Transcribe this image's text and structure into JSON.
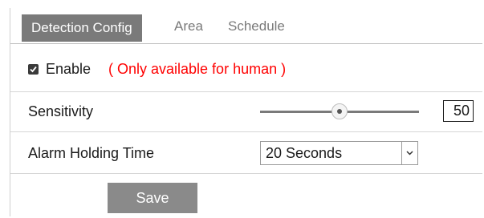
{
  "tabs": [
    {
      "label": "Detection Config",
      "active": true
    },
    {
      "label": "Area",
      "active": false
    },
    {
      "label": "Schedule",
      "active": false
    }
  ],
  "enable": {
    "checked": true,
    "label": "Enable",
    "note": "( Only available for human )",
    "note_color": "#ff0000"
  },
  "sensitivity": {
    "label": "Sensitivity",
    "value": "50",
    "level_percent": 50
  },
  "alarm": {
    "label": "Alarm Holding Time",
    "selected": "20 Seconds"
  },
  "actions": {
    "save_label": "Save"
  },
  "icons": {
    "checkbox": "check-icon",
    "dropdown": "chevron-down-icon"
  },
  "colors": {
    "active_tab_bg": "#7a7a7a",
    "button_bg": "#8a8a8a"
  }
}
